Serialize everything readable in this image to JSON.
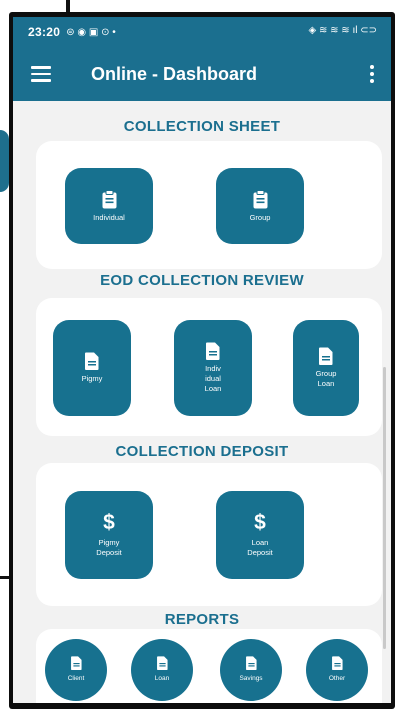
{
  "status_bar": {
    "time": "23:20",
    "left_icons": "⊜ ◉ ▣ ⊙ •",
    "right_icons": "◈ ≋ ≋ ≋ ıl ⊂⊃"
  },
  "app_bar": {
    "title": "Online - Dashboard"
  },
  "sections": {
    "collection_sheet": {
      "title": "COLLECTION SHEET",
      "tiles": [
        {
          "label": "Individual",
          "icon": "clipboard-icon"
        },
        {
          "label": "Group",
          "icon": "clipboard-icon"
        }
      ]
    },
    "eod_review": {
      "title": "EOD COLLECTION REVIEW",
      "tiles": [
        {
          "label": "Pigmy",
          "icon": "document-icon"
        },
        {
          "label": "Indiv\nidual\nLoan",
          "icon": "document-icon"
        },
        {
          "label": "Group\nLoan",
          "icon": "document-icon"
        }
      ]
    },
    "collection_deposit": {
      "title": "COLLECTION DEPOSIT",
      "tiles": [
        {
          "label": "Pigmy\nDeposit",
          "icon": "dollar-icon",
          "symbol": "$"
        },
        {
          "label": "Loan\nDeposit",
          "icon": "dollar-icon",
          "symbol": "$"
        }
      ]
    },
    "reports": {
      "title": "REPORTS",
      "tiles": [
        {
          "label": "Client",
          "icon": "document-icon"
        },
        {
          "label": "Loan",
          "icon": "document-icon"
        },
        {
          "label": "Savings",
          "icon": "document-icon"
        },
        {
          "label": "Other",
          "icon": "document-icon"
        }
      ]
    }
  },
  "colors": {
    "primary": "#1b6f8f",
    "tile": "#17718f",
    "background": "#f2f2f2",
    "card": "#ffffff"
  }
}
